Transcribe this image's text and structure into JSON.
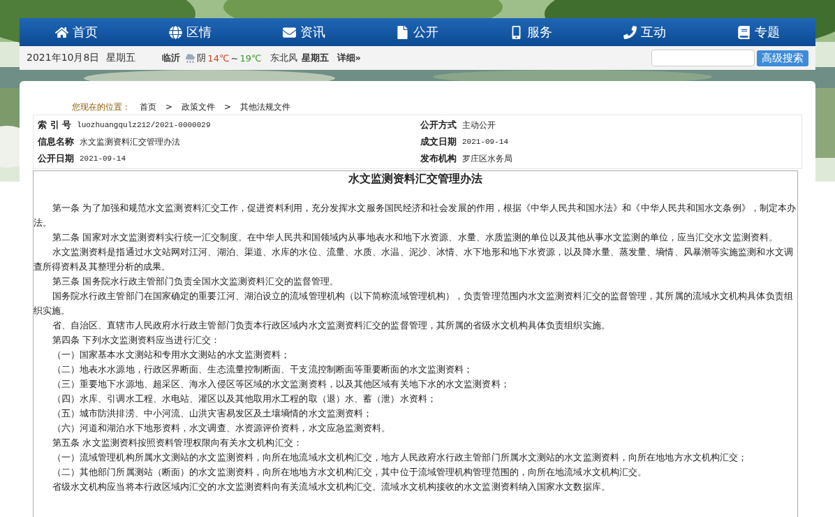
{
  "nav": [
    {
      "label": "首页"
    },
    {
      "label": "区情"
    },
    {
      "label": "资讯"
    },
    {
      "label": "公开"
    },
    {
      "label": "服务"
    },
    {
      "label": "互动"
    },
    {
      "label": "专题"
    }
  ],
  "info_bar": {
    "date": "2021年10月8日",
    "weekday": "星期五",
    "weather": {
      "city": "临沂",
      "condition": "阴",
      "low": "14℃",
      "tilde": "~",
      "high": "19℃",
      "wind": "东北风",
      "weekday": "星期五",
      "detail": "详细»"
    },
    "search": {
      "button": "高级搜索"
    }
  },
  "breadcrumb": {
    "label": "您现在的位置：",
    "separator": ">",
    "items": [
      "首页",
      "政策文件",
      "其他法规文件"
    ]
  },
  "meta": [
    {
      "label": "索 引 号",
      "value": "luozhuangqulz212/2021-0000029",
      "kind": "code"
    },
    {
      "label": "公开方式",
      "value": "主动公开",
      "kind": "text"
    },
    {
      "label": "信息名称",
      "value": "水文监测资料汇交管理办法",
      "kind": "text"
    },
    {
      "label": "成文日期",
      "value": "2021-09-14",
      "kind": "code"
    },
    {
      "label": "公开日期",
      "value": "2021-09-14",
      "kind": "code"
    },
    {
      "label": "发布机构",
      "value": "罗庄区水务局",
      "kind": "text"
    }
  ],
  "article": {
    "title": "水文监测资料汇交管理办法",
    "paragraphs": [
      "第一条 为了加强和规范水文监测资料汇交工作，促进资料利用，充分发挥水文服务国民经济和社会发展的作用，根据《中华人民共和国水法》和《中华人民共和国水文条例》，制定本办法。",
      "第二条 国家对水文监测资料实行统一汇交制度。在中华人民共和国领域内从事地表水和地下水资源、水量、水质监测的单位以及其他从事水文监测的单位，应当汇交水文监测资料。",
      "水文监测资料是指通过水文站网对江河、湖泊、渠道、水库的水位、流量、水质、水温、泥沙、冰情、水下地形和地下水资源，以及降水量、蒸发量、墒情、风暴潮等实施监测和水文调查所得资料及其整理分析的成果。",
      "第三条 国务院水行政主管部门负责全国水文监测资料汇交的监督管理。",
      "国务院水行政主管部门在国家确定的重要江河、湖泊设立的流域管理机构（以下简称流域管理机构），负责管理范围内水文监测资料汇交的监督管理，其所属的流域水文机构具体负责组织实施。",
      "省、自治区、直辖市人民政府水行政主管部门负责本行政区域内水文监测资料汇交的监督管理，其所属的省级水文机构具体负责组织实施。",
      "第四条 下列水文监测资料应当进行汇交：",
      "（一）国家基本水文测站和专用水文测站的水文监测资料；",
      "（二）地表水水源地，行政区界断面、生态流量控制断面、干支流控制断面等重要断面的水文监测资料；",
      "（三）重要地下水源地、超采区、海水入侵区等区域的水文监测资料，以及其他区域有关地下水的水文监测资料；",
      "（四）水库、引调水工程、水电站、灌区以及其他取用水工程的取（退）水、蓄（泄）水资料；",
      "（五）城市防洪排涝、中小河流、山洪灾害易发区及土壤墒情的水文监测资料；",
      "（六）河道和湖泊水下地形资料，水文调查、水资源评价资料，水文应急监测资料。",
      "第五条 水文监测资料按照资料管理权限向有关水文机构汇交：",
      "（一）流域管理机构所属水文测站的水文监测资料，向所在地流域水文机构汇交，地方人民政府水行政主管部门所属水文测站的水文监测资料，向所在地地方水文机构汇交；",
      "（二）其他部门所属测站（断面）的水文监测资料，向所在地地方水文机构汇交，其中位于流域管理机构管理范围的，向所在地流域水文机构汇交。",
      "省级水文机构应当将本行政区域内汇交的水文监测资料向有关流域水文机构汇交。流域水文机构接收的水文监测资料纳入国家水文数据库。"
    ]
  }
}
